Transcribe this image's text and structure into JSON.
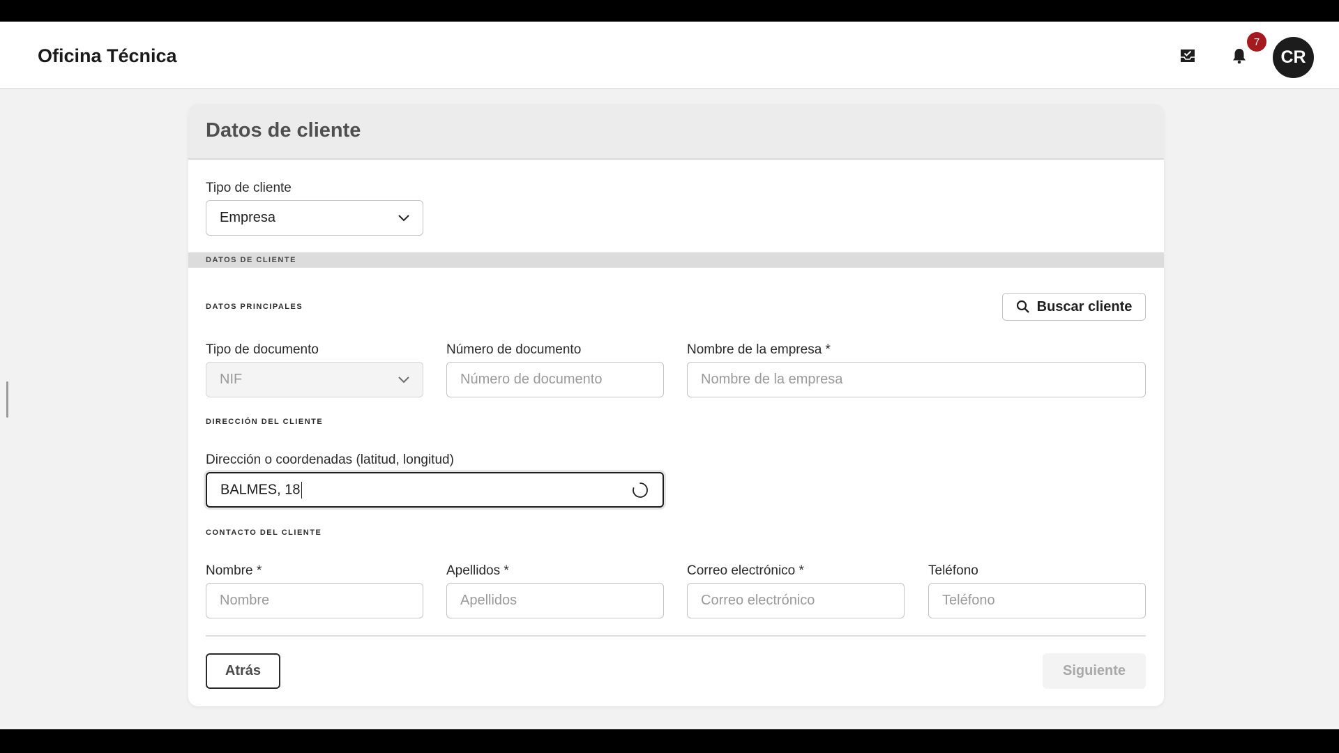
{
  "app": {
    "title": "Oficina Técnica",
    "notification_count": "7",
    "user_initials": "CR",
    "icons": {
      "inbox": "inbox-check-icon",
      "notifications": "bell-icon"
    }
  },
  "form": {
    "title": "Datos de cliente",
    "client_type": {
      "label": "Tipo de cliente",
      "value": "Empresa"
    },
    "band_title": "DATOS DE CLIENTE",
    "main_section": "DATOS PRINCIPALES",
    "search_button": "Buscar cliente",
    "doc_type": {
      "label": "Tipo de documento",
      "value": "NIF"
    },
    "doc_number": {
      "label": "Número de documento",
      "placeholder": "Número de documento"
    },
    "company_name": {
      "label": "Nombre de la empresa *",
      "placeholder": "Nombre de la empresa"
    },
    "address_section": "DIRECCIÓN DEL CLIENTE",
    "address": {
      "label": "Dirección o coordenadas (latitud, longitud)",
      "value": "BALMES, 18"
    },
    "contact_section": "CONTACTO DEL CLIENTE",
    "first_name": {
      "label": "Nombre *",
      "placeholder": "Nombre"
    },
    "last_name": {
      "label": "Apellidos *",
      "placeholder": "Apellidos"
    },
    "email": {
      "label": "Correo electrónico *",
      "placeholder": "Correo electrónico"
    },
    "phone": {
      "label": "Teléfono",
      "placeholder": "Teléfono"
    },
    "back_button": "Atrás",
    "next_button": "Siguiente"
  },
  "colors": {
    "badge": "#a51a1f",
    "avatar": "#1c1c1c",
    "header_band": "#ececec"
  }
}
